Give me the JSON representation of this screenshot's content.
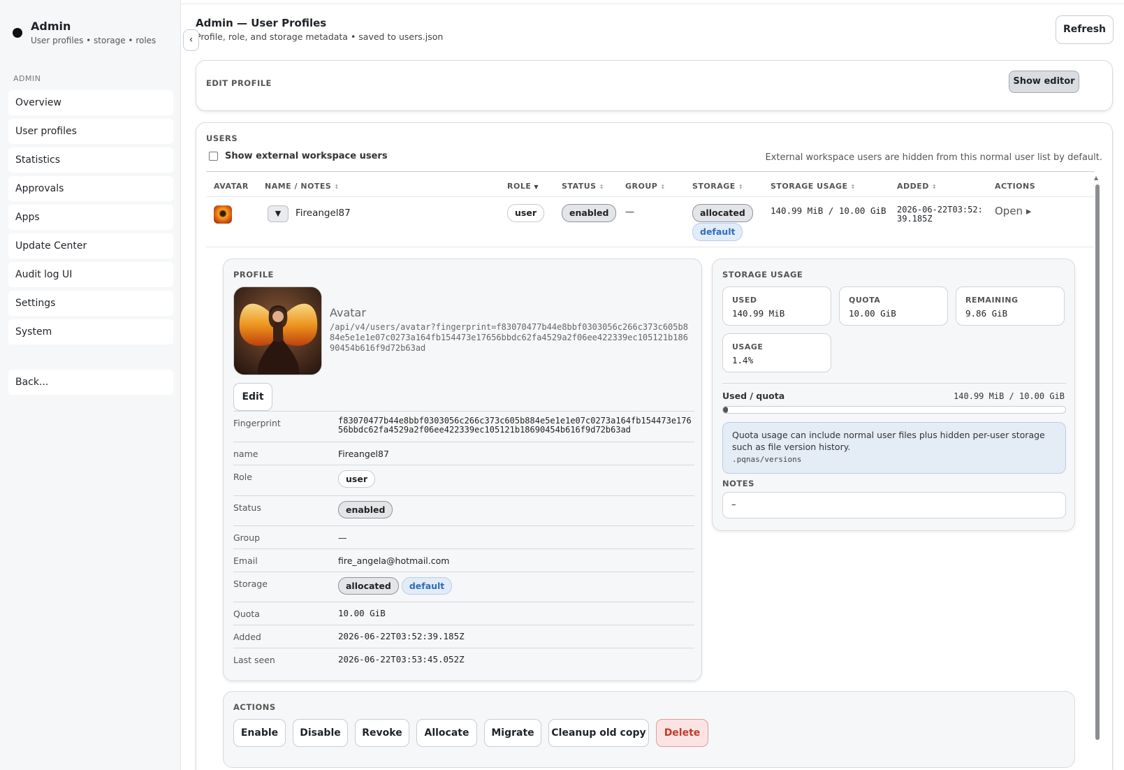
{
  "sidebar": {
    "title": "Admin",
    "subtitle": "User profiles • storage • roles",
    "section": "ADMIN",
    "items": [
      {
        "label": "Overview"
      },
      {
        "label": "User profiles"
      },
      {
        "label": "Statistics"
      },
      {
        "label": "Approvals"
      },
      {
        "label": "Apps"
      },
      {
        "label": "Update Center"
      },
      {
        "label": "Audit log UI"
      },
      {
        "label": "Settings"
      },
      {
        "label": "System"
      }
    ],
    "back": "Back..."
  },
  "header": {
    "title": "Admin — User Profiles",
    "subtitle": "Profile, role, and storage metadata • saved to users.json",
    "refresh": "Refresh",
    "collapse_glyph": "‹"
  },
  "edit_profile": {
    "heading": "EDIT PROFILE",
    "show_editor": "Show editor"
  },
  "users": {
    "heading": "USERS",
    "show_external": "Show external workspace users",
    "external_note": "External workspace users are hidden from this normal user list by default.",
    "columns": [
      "AVATAR",
      "NAME / NOTES",
      "ROLE",
      "STATUS",
      "GROUP",
      "STORAGE",
      "STORAGE USAGE",
      "ADDED",
      "ACTIONS"
    ],
    "row": {
      "toggle": "▼",
      "name": "Fireangel87",
      "role": "user",
      "status": "enabled",
      "group": "—",
      "storage": "allocated",
      "storage_tag": "default",
      "usage": "140.99 MiB / 10.00 GiB",
      "added": "2026-06-22T03:52:39.185Z",
      "action": "Open ▸"
    }
  },
  "profile": {
    "heading": "PROFILE",
    "avatar_label": "Avatar",
    "avatar_url": "/api/v4/users/avatar?fingerprint=f83070477b44e8bbf0303056c266c373c605b884e5e1e1e07c0273a164fb154473e17656bbdc62fa4529a2f06ee422339ec105121b18690454b616f9d72b63ad",
    "edit": "Edit",
    "fields": {
      "fingerprint_label": "Fingerprint",
      "fingerprint": "f83070477b44e8bbf0303056c266c373c605b884e5e1e1e07c0273a164fb154473e17656bbdc62fa4529a2f06ee422339ec105121b18690454b616f9d72b63ad",
      "name_label": "name",
      "name": "Fireangel87",
      "role_label": "Role",
      "role": "user",
      "status_label": "Status",
      "status": "enabled",
      "group_label": "Group",
      "group": "—",
      "email_label": "Email",
      "email": "fire_angela@hotmail.com",
      "storage_label": "Storage",
      "storage": "allocated",
      "storage_tag": "default",
      "quota_label": "Quota",
      "quota": "10.00 GiB",
      "added_label": "Added",
      "added": "2026-06-22T03:52:39.185Z",
      "last_seen_label": "Last seen",
      "last_seen": "2026-06-22T03:53:45.052Z"
    }
  },
  "storage_usage": {
    "heading": "STORAGE USAGE",
    "used_label": "USED",
    "used": "140.99 MiB",
    "quota_label": "QUOTA",
    "quota": "10.00 GiB",
    "remaining_label": "REMAINING",
    "remaining": "9.86 GiB",
    "usage_label": "USAGE",
    "usage": "1.4%",
    "bar_label": "Used / quota",
    "bar_value": "140.99 MiB / 10.00 GiB",
    "fill_fraction": 0.014,
    "note": "Quota usage can include normal user files plus hidden per-user storage such as file version history.",
    "note_code": ".pqnas/versions",
    "notes_heading": "NOTES",
    "notes_value": "–"
  },
  "actions": {
    "heading": "ACTIONS",
    "buttons": [
      "Enable",
      "Disable",
      "Revoke",
      "Allocate",
      "Migrate",
      "Cleanup old copy",
      "Delete"
    ],
    "delete_color": "#c0392b"
  }
}
